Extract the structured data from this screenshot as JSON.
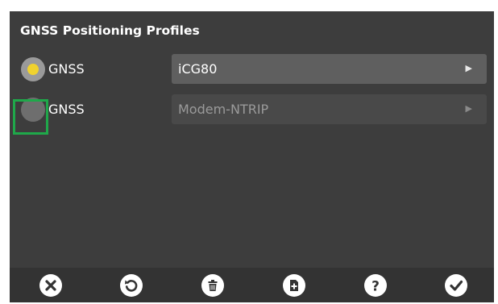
{
  "dialog": {
    "title": "GNSS Positioning Profiles",
    "profiles": [
      {
        "label": "GNSS",
        "selected": true,
        "value": "iCG80",
        "enabled": true
      },
      {
        "label": "GNSS",
        "selected": false,
        "value": "Modem-NTRIP",
        "enabled": false
      }
    ]
  },
  "toolbar": {
    "buttons": [
      {
        "icon": "close-icon"
      },
      {
        "icon": "reset-icon"
      },
      {
        "icon": "delete-icon"
      },
      {
        "icon": "add-icon"
      },
      {
        "icon": "help-icon"
      },
      {
        "icon": "check-icon"
      }
    ]
  },
  "colors": {
    "background": "#3d3d3d",
    "toolbar": "#333333",
    "radio_selected": "#f0d22e",
    "highlight": "#1fa84a"
  }
}
